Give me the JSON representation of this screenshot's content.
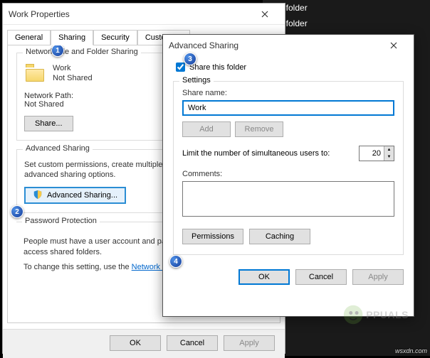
{
  "sidebar": {
    "items": [
      "File folder",
      "File folder"
    ]
  },
  "props": {
    "title": "Work Properties",
    "tabs": [
      "General",
      "Sharing",
      "Security",
      "Customize"
    ],
    "active_tab_index": 1,
    "nffs": {
      "group_label": "Network File and Folder Sharing",
      "folder_name": "Work",
      "share_status": "Not Shared",
      "np_label": "Network Path:",
      "np_value": "Not Shared",
      "share_btn": "Share..."
    },
    "adv": {
      "group_label": "Advanced Sharing",
      "desc": "Set custom permissions, create multiple shares, and set other advanced sharing options.",
      "btn": "Advanced Sharing..."
    },
    "pp": {
      "group_label": "Password Protection",
      "line1": "People must have a user account and password for this computer to access shared folders.",
      "line2_prefix": "To change this setting, use the ",
      "link": "Network and Sharing Center"
    },
    "footer": {
      "ok": "OK",
      "cancel": "Cancel",
      "apply": "Apply"
    }
  },
  "advdlg": {
    "title": "Advanced Sharing",
    "share_chk": "Share this folder",
    "settings_label": "Settings",
    "share_name_label": "Share name:",
    "share_name_value": "Work",
    "add_btn": "Add",
    "remove_btn": "Remove",
    "limit_label": "Limit the number of simultaneous users to:",
    "limit_value": "20",
    "comments_label": "Comments:",
    "comments_value": "",
    "permissions_btn": "Permissions",
    "caching_btn": "Caching",
    "ok": "OK",
    "cancel": "Cancel",
    "apply": "Apply"
  },
  "callouts": {
    "c1": "1",
    "c2": "2",
    "c3": "3",
    "c4": "4"
  },
  "watermark": {
    "site": "wsxdn.com",
    "brand": "PPUALS"
  }
}
